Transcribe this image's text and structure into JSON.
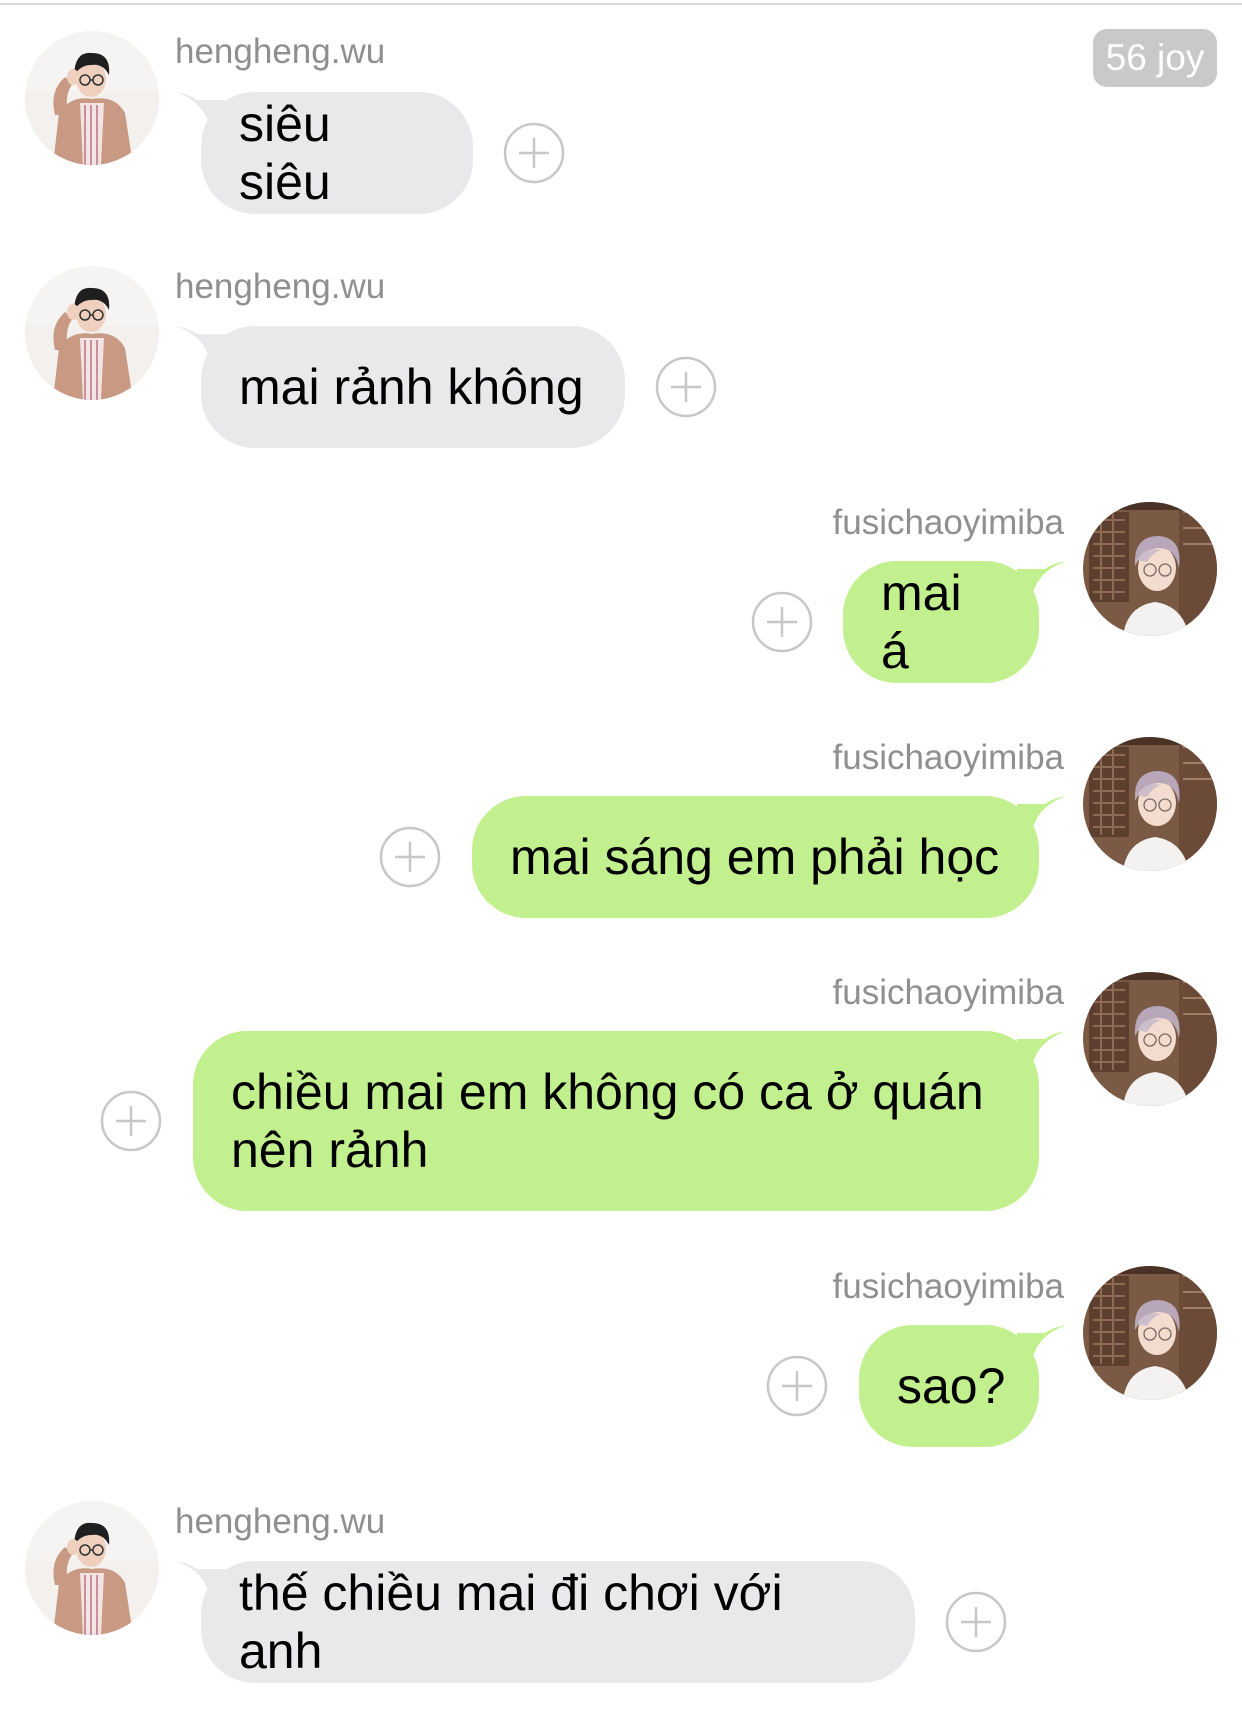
{
  "badge": {
    "label": "56 joy"
  },
  "colors": {
    "incoming_bubble": "#e9e9ec",
    "outgoing_bubble": "#c2f08f",
    "sender_name": "#8f8f8f",
    "plus_icon": "#c7c7c7"
  },
  "messages": [
    {
      "sender": "hengheng.wu",
      "text": "siêu siêu",
      "direction": "incoming"
    },
    {
      "sender": "hengheng.wu",
      "text": "mai rảnh không",
      "direction": "incoming"
    },
    {
      "sender": "fusichaoyimiba",
      "text": "mai á",
      "direction": "outgoing"
    },
    {
      "sender": "fusichaoyimiba",
      "text": "mai sáng em phải học",
      "direction": "outgoing"
    },
    {
      "sender": "fusichaoyimiba",
      "text": "chiều mai em không có ca ở quán\nnên rảnh",
      "direction": "outgoing"
    },
    {
      "sender": "fusichaoyimiba",
      "text": "sao?",
      "direction": "outgoing"
    },
    {
      "sender": "hengheng.wu",
      "text": "thế chiều mai đi chơi với anh",
      "direction": "incoming"
    }
  ]
}
